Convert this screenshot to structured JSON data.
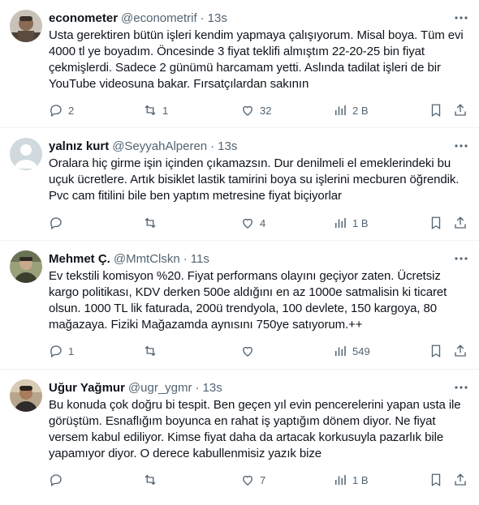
{
  "tweets": [
    {
      "name": "econometer",
      "handle": "@econometrif",
      "time": "13s",
      "text": "Usta gerektiren bütün işleri kendim yapmaya çalışıyorum. Misal boya. Tüm evi 4000 tl ye boyadım. Öncesinde 3 fiyat teklifi almıştım 22-20-25 bin fiyat çekmişlerdi. Sadece 2 günümü harcamam yetti. Aslında tadilat işleri de bir YouTube videosuna bakar. Fırsatçılardan sakının",
      "replies": "2",
      "retweets": "1",
      "likes": "32",
      "views": "2 B"
    },
    {
      "name": "yalnız kurt",
      "handle": "@SeyyahAlperen",
      "time": "13s",
      "text": "Oralara hiç girme işin içinden çıkamazsın.  Dur denilmeli el emeklerindeki bu uçuk ücretlere.  Artık bisiklet lastik tamirini boya su işlerini mecburen öğrendik. Pvc cam fitilini bile ben yaptım metresine fiyat biçiyorlar",
      "replies": "",
      "retweets": "",
      "likes": "4",
      "views": "1 B"
    },
    {
      "name": "Mehmet Ç.",
      "handle": "@MmtClskn",
      "time": "11s",
      "text": "Ev tekstili komisyon %20. Fiyat performans olayını geçiyor zaten. Ücretsiz kargo politikası, KDV derken 500e aldığını en az 1000e satmalisin ki ticaret olsun. 1000 TL lik faturada, 200ü trendyola, 100 devlete, 150 kargoya, 80 mağazaya. Fiziki Mağazamda aynısını 750ye satıyorum.++",
      "replies": "1",
      "retweets": "",
      "likes": "",
      "views": "549"
    },
    {
      "name": "Uğur Yağmur",
      "handle": "@ugr_ygmr",
      "time": "13s",
      "text": "Bu konuda çok doğru bi tespit. Ben geçen yıl evin pencerelerini yapan usta ile görüştüm.  Esnaflığım boyunca en rahat iş yaptığım dönem diyor. Ne fiyat versem kabul ediliyor.  Kimse fiyat daha da artacak korkusuyla pazarlık bile yapamıyor diyor. O derece kabullenmisiz yazık bize",
      "replies": "",
      "retweets": "",
      "likes": "7",
      "views": "1 B"
    }
  ],
  "colors": {
    "text": "#0f1419",
    "secondary": "#536471",
    "divider": "#eff3f4"
  },
  "icons": {
    "reply": "reply-icon",
    "retweet": "retweet-icon",
    "like": "like-icon",
    "views": "views-icon",
    "bookmark": "bookmark-icon",
    "share": "share-icon",
    "more": "more-icon"
  }
}
